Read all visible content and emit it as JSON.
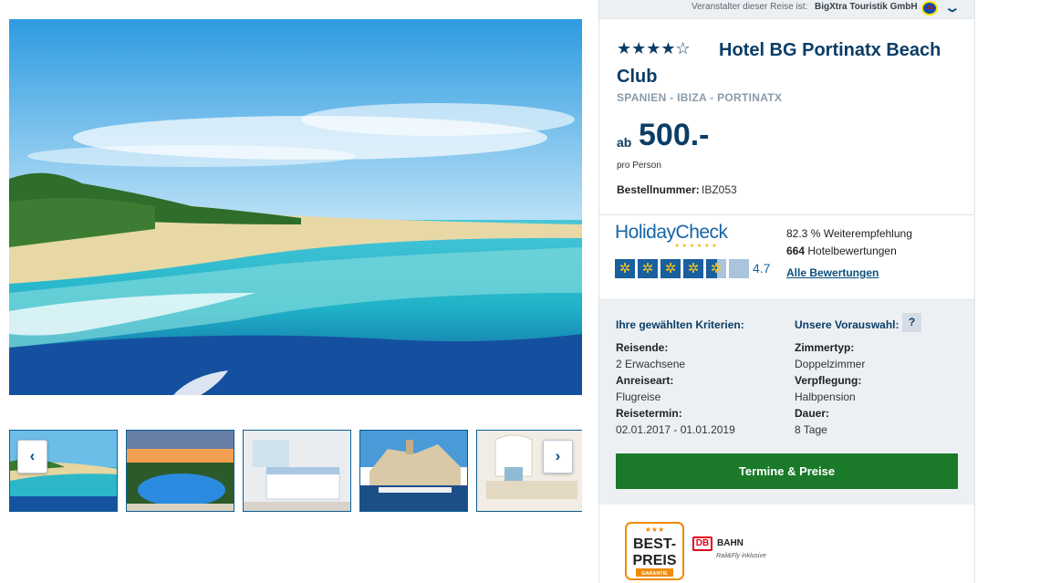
{
  "operator_bar": {
    "label": "Veranstalter dieser Reise ist:",
    "operator": "BigXtra Touristik GmbH",
    "logo_text": "LIDL",
    "expand_icon": "chevron-down-icon"
  },
  "gallery": {
    "prev_label": "‹",
    "next_label": "›",
    "main_image": "beach-bay-image",
    "thumbnails": [
      "beach-thumb",
      "pool-thumb",
      "room-thumb",
      "harbour-town-thumb",
      "lounge-thumb"
    ]
  },
  "hotel": {
    "rating_stars": 4.5,
    "stars_display": "★★★★☆",
    "name": "Hotel BG Portinatx Beach Club",
    "location": "SPANIEN - IBIZA - PORTINATX",
    "price_prefix": "ab",
    "price": "500.-",
    "price_note": "pro Person",
    "order_label": "Bestellnummer:",
    "order_number": "IBZ053"
  },
  "holidaycheck": {
    "logo": "HolidayCheck",
    "logo_dots": "● ● ● ● ● ●",
    "suns": 4.5,
    "sun_icon": "✲",
    "score": "4.7",
    "recommendation_value": "82.3 %",
    "recommendation_label": "Weiterempfehlung",
    "reviews_count": "664",
    "reviews_label": "Hotelbewertungen",
    "all_reviews_link": "Alle Bewertungen"
  },
  "criteria": {
    "heading": "Ihre gewählten Kriterien:",
    "items": [
      {
        "label": "Reisende:",
        "value": "2 Erwachsene"
      },
      {
        "label": "Anreiseart:",
        "value": "Flugreise"
      },
      {
        "label": "Reisetermin:",
        "value": "02.01.2017 - 01.01.2019"
      }
    ]
  },
  "preselection": {
    "heading": "Unsere Vorauswahl:",
    "help_label": "?",
    "items": [
      {
        "label": "Zimmertyp:",
        "value": "Doppelzimmer"
      },
      {
        "label": "Verpflegung:",
        "value": "Halbpension"
      },
      {
        "label": "Dauer:",
        "value": "8 Tage"
      }
    ]
  },
  "cta": {
    "label": "Termine & Preise"
  },
  "badges": {
    "best_price_stars": "★★★",
    "best_price_line1": "BEST-",
    "best_price_line2": "PREIS",
    "best_price_line3": "GARANTIE",
    "db_logo": "DB",
    "db_name": "BAHN",
    "db_sub": "Rail&Fly inklusive"
  },
  "colors": {
    "brand_dark": "#0a3d66",
    "cta_green": "#1a7a2a",
    "panel_bg": "#ecf0f3",
    "hc_blue": "#1565a8",
    "hc_sun": "#f7c71d"
  }
}
